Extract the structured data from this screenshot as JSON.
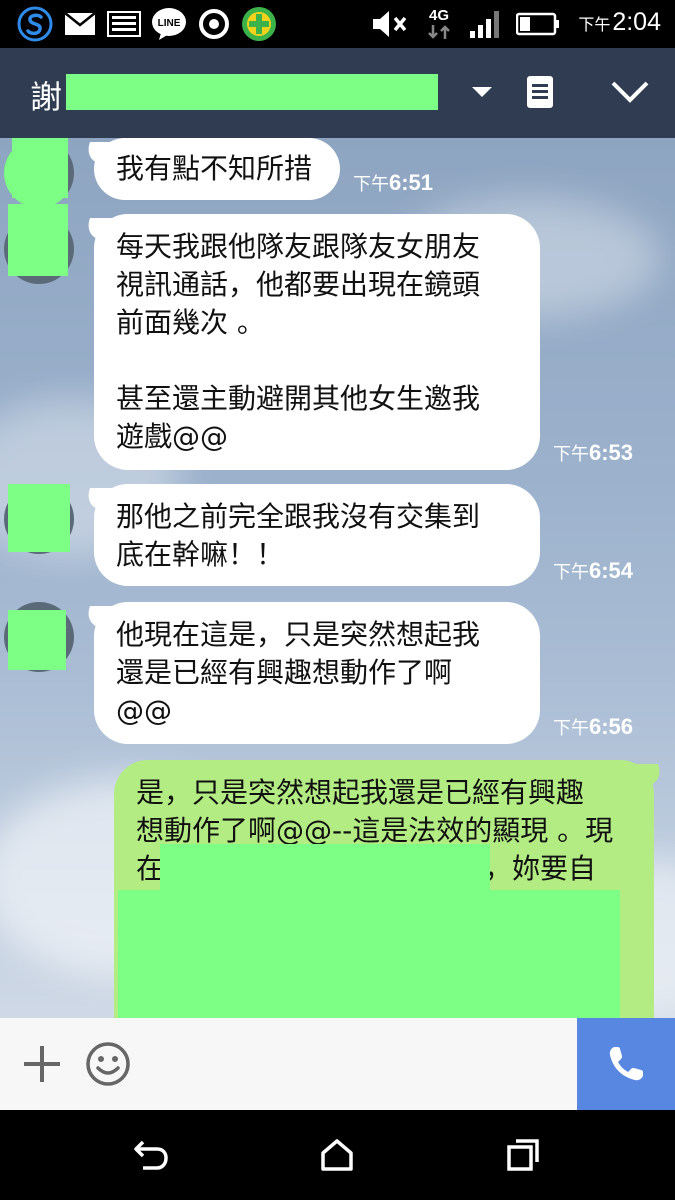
{
  "status_bar": {
    "time_prefix": "下午",
    "time": "2:04",
    "network": "4G",
    "icons": [
      "swift-s-icon",
      "mail-icon",
      "image-icon",
      "line-app-icon",
      "target-icon",
      "plus-app-icon",
      "mute-icon",
      "signal-icon",
      "battery-icon"
    ],
    "line_label": "LINE"
  },
  "header": {
    "title_char": "謝",
    "icons": [
      "dropdown-arrow-icon",
      "notes-icon",
      "collapse-chevron-icon"
    ]
  },
  "messages": [
    {
      "sender": "other",
      "lines": [
        "我有點不知所措"
      ],
      "time_prefix": "下午",
      "time": "6:51"
    },
    {
      "sender": "other",
      "lines": [
        "每天我跟他隊友跟隊友女朋友",
        "視訊通話，他都要出現在鏡頭",
        "前面幾次 。",
        "",
        "甚至還主動避開其他女生邀我",
        "遊戲@@"
      ],
      "time_prefix": "下午",
      "time": "6:53"
    },
    {
      "sender": "other",
      "lines": [
        "那他之前完全跟我沒有交集到",
        "底在幹嘛！！"
      ],
      "time_prefix": "下午",
      "time": "6:54"
    },
    {
      "sender": "other",
      "lines": [
        "他現在這是，只是突然想起我",
        "還是已經有興趣想動作了啊",
        "@@"
      ],
      "time_prefix": "下午",
      "time": "6:56"
    },
    {
      "sender": "me",
      "lines": [
        "是，只是突然想起我還是已經有興趣",
        "想動作了啊@@--這是法效的顯現 。現",
        "在",
        "話，妳要自"
      ]
    }
  ],
  "input_bar": {
    "icons": [
      "add-icon",
      "emoji-icon",
      "phone-call-icon"
    ]
  },
  "nav_bar": {
    "icons": [
      "back-icon",
      "home-icon",
      "recents-icon"
    ]
  },
  "colors": {
    "header_bg": "#2f3c52",
    "my_bubble": "#b4ec84",
    "call_button": "#5787e0",
    "redaction": "#7dff86"
  }
}
